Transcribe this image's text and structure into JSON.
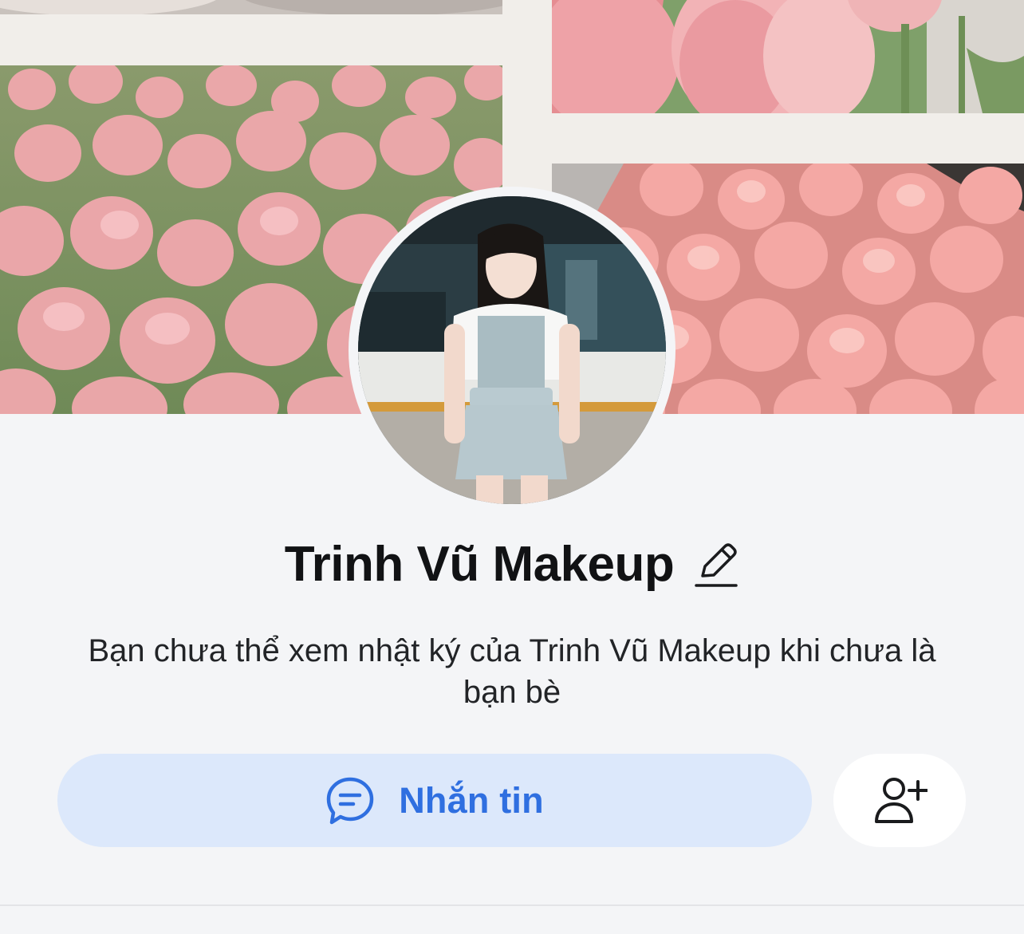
{
  "profile": {
    "name": "Trinh Vũ Makeup",
    "notice": "Bạn chưa thể xem nhật ký của Trinh Vũ Makeup khi chưa là bạn bè"
  },
  "actions": {
    "message_label": "Nhắn tin"
  },
  "icons": {
    "edit": "pencil-icon",
    "message": "chat-bubble-icon",
    "add_friend": "add-person-icon"
  },
  "colors": {
    "background": "#f4f5f7",
    "message_button_bg": "#dce8fb",
    "accent_blue": "#2f6fe0",
    "name_text": "#111214"
  }
}
